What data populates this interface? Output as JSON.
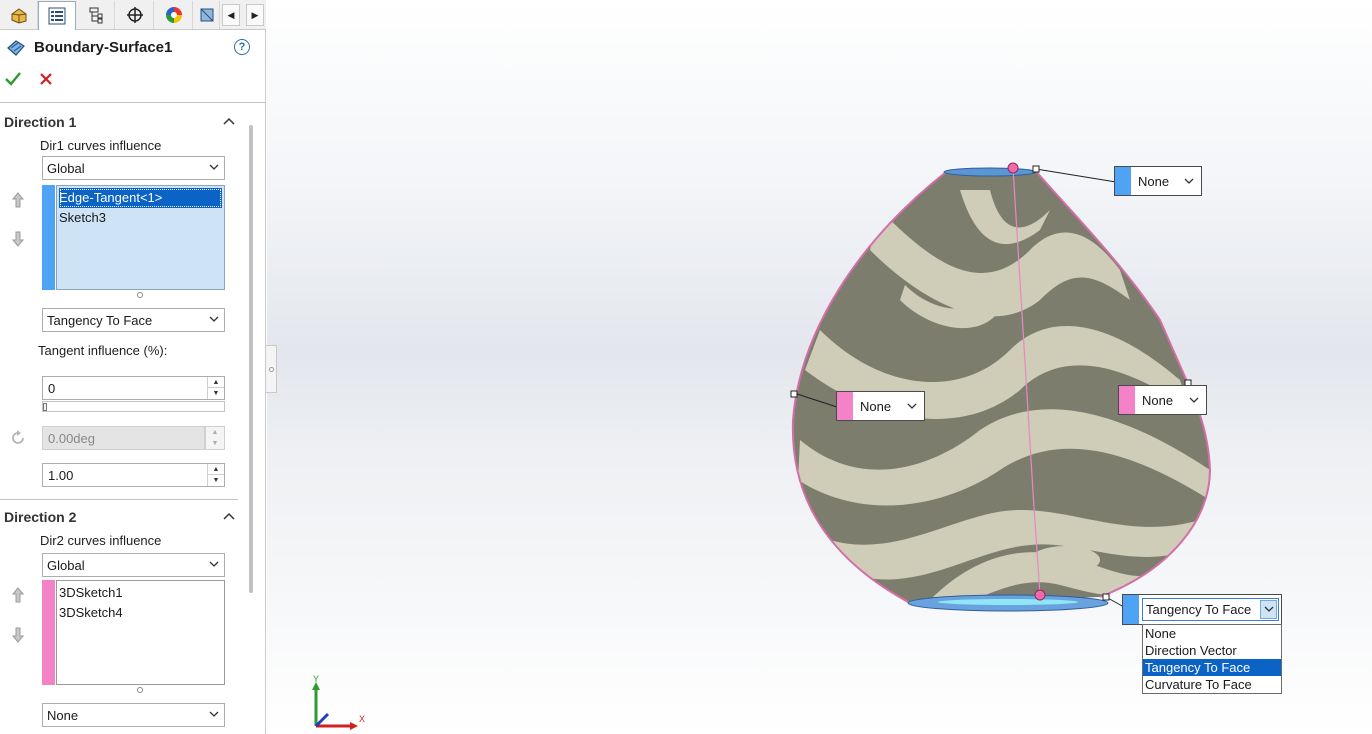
{
  "feature": {
    "title": "Boundary-Surface1",
    "help": "?"
  },
  "tabs": [
    {
      "name": "feature-manager"
    },
    {
      "name": "property-manager"
    },
    {
      "name": "configuration-manager"
    },
    {
      "name": "dimxpert-manager"
    },
    {
      "name": "display-manager"
    },
    {
      "name": "cam-manager"
    }
  ],
  "direction1": {
    "heading": "Direction 1",
    "influence_label": "Dir1 curves influence",
    "influence_value": "Global",
    "curves": [
      "Edge-Tangent<1>",
      "Sketch3"
    ],
    "tangency_value": "Tangency To Face",
    "tangent_label": "Tangent influence (%):",
    "tangent_value": "0",
    "angle_value": "0.00deg",
    "length_value": "1.00",
    "color": "#4ea3f4"
  },
  "direction2": {
    "heading": "Direction 2",
    "influence_label": "Dir2 curves influence",
    "influence_value": "Global",
    "curves": [
      "3DSketch1",
      "3DSketch4"
    ],
    "tangency_value": "None",
    "color": "#f383c6"
  },
  "viewport": {
    "callouts": {
      "top": "None",
      "left": "None",
      "right": "None",
      "bottom": "Tangency To Face"
    },
    "dropdown_options": [
      "None",
      "Direction Vector",
      "Tangency To Face",
      "Curvature To Face"
    ],
    "dropdown_selected": "Tangency To Face",
    "triad": {
      "y": "Y",
      "x": "X"
    }
  }
}
